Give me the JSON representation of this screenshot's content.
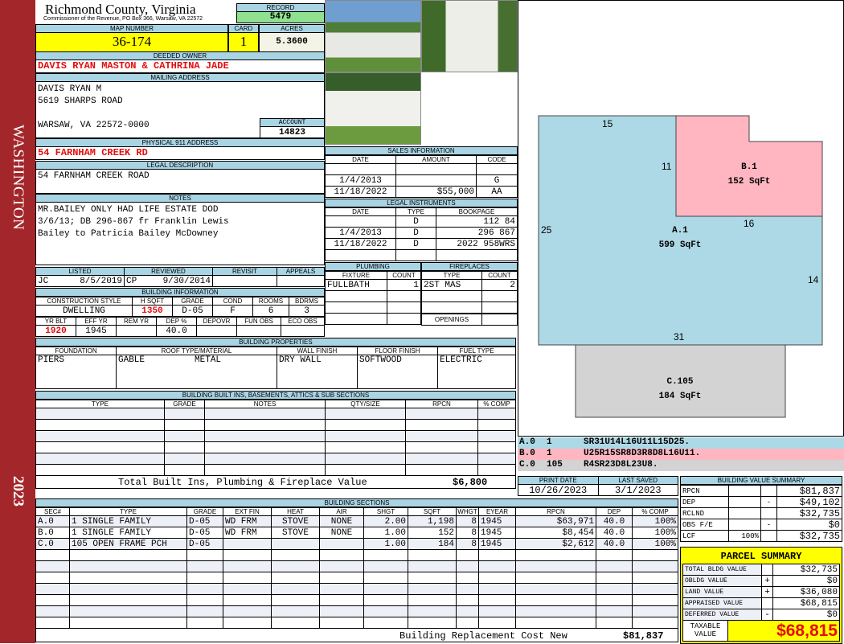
{
  "sidebar": {
    "district": "WASHINGTON",
    "year": "2023"
  },
  "header": {
    "county": "Richmond County, Virginia",
    "subtitle": "Commissioner of the Revenue, PO Box 366, Warsaw, VA 22572",
    "record_label": "RECORD",
    "record": "5479"
  },
  "parcel": {
    "map_label": "MAP NUMBER",
    "map_number": "36-174",
    "card_label": "CARD",
    "card": "1",
    "acres_label": "ACRES",
    "acres": "5.3600"
  },
  "owner": {
    "label": "DEEDED OWNER",
    "value": "DAVIS RYAN MASTON & CATHRINA JADE"
  },
  "mailing": {
    "label": "MAILING ADDRESS",
    "line1": "DAVIS RYAN M",
    "line2": "5619 SHARPS ROAD",
    "line3": "WARSAW, VA 22572-0000",
    "account_label": "ACCOUNT",
    "account": "14823"
  },
  "physical": {
    "label": "PHYSICAL 911 ADDRESS",
    "value": "54 FARNHAM CREEK RD"
  },
  "legal": {
    "label": "LEGAL DESCRIPTION",
    "value": "54 FARNHAM CREEK ROAD"
  },
  "notes": {
    "label": "NOTES",
    "line1": "MR.BAILEY ONLY HAD LIFE ESTATE DOD",
    "line2": "3/6/13; DB 296-867 fr Franklin Lewis",
    "line3": "Bailey to Patricia Bailey McDowney"
  },
  "review": {
    "listed_label": "LISTED",
    "listed_by": "JC",
    "listed_date": "8/5/2019",
    "reviewed_label": "REVIEWED",
    "reviewed_by": "CP",
    "reviewed_date": "9/30/2014",
    "revisit_label": "REVISIT",
    "appeals_label": "APPEALS"
  },
  "building_info": {
    "label": "BUILDING INFORMATION",
    "h1": [
      "CONSTRUCTION STYLE",
      "H SQFT",
      "GRADE",
      "COND",
      "ROOMS",
      "BDRMS"
    ],
    "v1": [
      "DWELLING",
      "1350",
      "D-05",
      "F",
      "6",
      "3"
    ],
    "h2": [
      "YR BLT",
      "EFF YR",
      "REM YR",
      "DEP %",
      "DEPOVR",
      "FUN OBS",
      "ECO OBS"
    ],
    "v2": [
      "1920",
      "1945",
      "",
      "40.0",
      "",
      "",
      ""
    ]
  },
  "properties": {
    "label": "BUILDING PROPERTIES",
    "headers": [
      "FOUNDATION",
      "ROOF TYPE/MATERIAL",
      "WALL FINISH",
      "FLOOR FINISH",
      "FUEL TYPE"
    ],
    "foundation": "PIERS",
    "roof_type": "GABLE",
    "roof_material": "METAL",
    "wall": "DRY WALL",
    "floor": "SOFTWOOD",
    "fuel": "ELECTRIC"
  },
  "builtins": {
    "label": "BUILDING BUILT INS, BASEMENTS, ATTICS & SUB SECTIONS",
    "headers": [
      "TYPE",
      "GRADE",
      "NOTES",
      "QTY/SIZE",
      "RPCN",
      "% COMP"
    ],
    "total_label": "Total Built Ins, Plumbing & Fireplace Value",
    "total": "$6,800"
  },
  "sections": {
    "label": "BUILDING SECTIONS",
    "headers": [
      "SEC#",
      "TYPE",
      "GRADE",
      "EXT FIN",
      "HEAT",
      "AIR",
      "SHGT",
      "SQFT",
      "WHGT",
      "EYEAR",
      "RPCN",
      "DEP",
      "% COMP"
    ],
    "rows": [
      [
        "A.0",
        "1 SINGLE FAMILY",
        "D-05",
        "WD FRM",
        "STOVE",
        "NONE",
        "2.00",
        "1,198",
        "8",
        "1945",
        "$63,971",
        "40.0",
        "100%"
      ],
      [
        "B.0",
        "1 SINGLE FAMILY",
        "D-05",
        "WD FRM",
        "STOVE",
        "NONE",
        "1.00",
        "152",
        "8",
        "1945",
        "$8,454",
        "40.0",
        "100%"
      ],
      [
        "C.0",
        "105 OPEN FRAME PCH",
        "D-05",
        "",
        "",
        "",
        "1.00",
        "184",
        "8",
        "1945",
        "$2,612",
        "40.0",
        "100%"
      ]
    ],
    "replacement_label": "Building Replacement Cost New",
    "replacement": "$81,837"
  },
  "sales": {
    "label": "SALES INFORMATION",
    "headers": [
      "DATE",
      "AMOUNT",
      "CODE"
    ],
    "rows": [
      [
        "",
        "",
        ""
      ],
      [
        "1/4/2013",
        "",
        "G"
      ],
      [
        "11/18/2022",
        "$55,000",
        "AA"
      ]
    ]
  },
  "instruments": {
    "label": "LEGAL INSTRUMENTS",
    "headers": [
      "DATE",
      "TYPE",
      "BOOKPAGE"
    ],
    "rows": [
      [
        "",
        "D",
        "112 84"
      ],
      [
        "1/4/2013",
        "D",
        "296 867"
      ],
      [
        "11/18/2022",
        "D",
        "2022 958WRS"
      ],
      [
        "",
        "",
        ""
      ]
    ]
  },
  "plumbing": {
    "label": "PLUMBING",
    "headers": [
      "FIXTURE",
      "COUNT"
    ],
    "rows": [
      [
        "FULLBATH",
        "1"
      ],
      [
        "",
        ""
      ],
      [
        "",
        ""
      ],
      [
        "",
        ""
      ]
    ]
  },
  "fireplaces": {
    "label": "FIREPLACES",
    "headers": [
      "TYPE",
      "COUNT"
    ],
    "rows": [
      [
        "2ST MAS",
        "2"
      ],
      [
        "",
        ""
      ],
      [
        "",
        ""
      ]
    ],
    "openings_label": "OPENINGS"
  },
  "sketch": {
    "labels": {
      "a_name": "A.1",
      "a_area": "599 SqFt",
      "b_name": "B.1",
      "b_area": "152 SqFt",
      "c_name": "C.105",
      "c_area": "184 SqFt"
    },
    "dims": {
      "top": "15",
      "b_left": "11",
      "b_bottom": "16",
      "a_left": "25",
      "a_right": "14",
      "a_bottom": "31"
    },
    "colors": {
      "a": "#add8e6",
      "b": "#ffb6c1",
      "c": "#d3d3d3"
    },
    "legend": [
      [
        "A.0",
        "1",
        "SR31U14L16U11L15D25."
      ],
      [
        "B.0",
        "1",
        "U25R15SR8D3R8D8L16U11."
      ],
      [
        "C.0",
        "105",
        "R4SR23D8L23U8."
      ]
    ]
  },
  "dates": {
    "print_label": "PRINT DATE",
    "print": "10/26/2023",
    "saved_label": "LAST SAVED",
    "saved": "3/1/2023"
  },
  "value_summary": {
    "label": "BUILDING VALUE SUMMARY",
    "rows": [
      [
        "RPCN",
        "",
        "",
        "$81,837"
      ],
      [
        "DEP",
        "",
        "-",
        "$49,102"
      ],
      [
        "RCLND",
        "",
        "",
        "$32,735"
      ],
      [
        "OBS F/E",
        "",
        "-",
        "$0"
      ],
      [
        "LCF",
        "100%",
        "",
        "$32,735"
      ]
    ]
  },
  "parcel_summary": {
    "label": "PARCEL SUMMARY",
    "rows": [
      [
        "TOTAL BLDG VALUE",
        "",
        "$32,735"
      ],
      [
        "OBLDG VALUE",
        "+",
        "$0"
      ],
      [
        "LAND VALUE",
        "+",
        "$36,080"
      ],
      [
        "APPRAISED VALUE",
        "",
        "$68,815"
      ],
      [
        "DEFERRED VALUE",
        "-",
        "$0"
      ]
    ],
    "taxable_label": "TAXABLE VALUE",
    "taxable": "$68,815"
  }
}
